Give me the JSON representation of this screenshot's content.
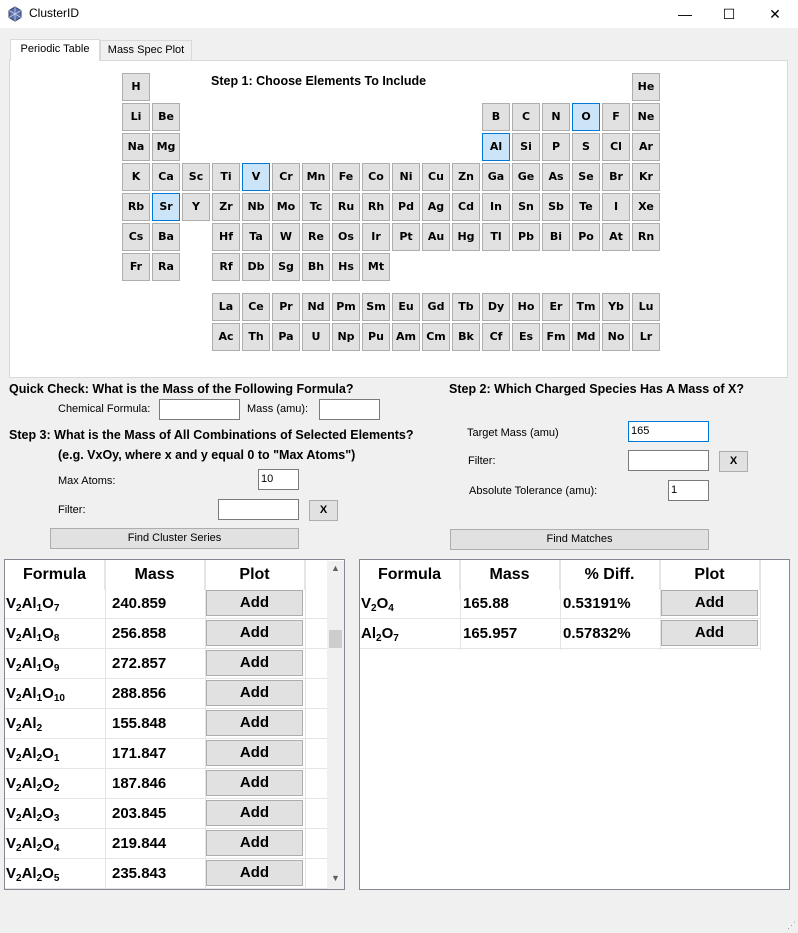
{
  "window": {
    "title": "ClusterID",
    "minimize": "—",
    "maximize": "☐",
    "close": "✕"
  },
  "tabs": [
    "Periodic Table",
    "Mass Spec Plot"
  ],
  "step1": {
    "title": "Step 1: Choose Elements To Include",
    "elements": [
      {
        "s": "H",
        "r": 0,
        "c": 0
      },
      {
        "s": "He",
        "r": 0,
        "c": 17
      },
      {
        "s": "Li",
        "r": 1,
        "c": 0
      },
      {
        "s": "Be",
        "r": 1,
        "c": 1
      },
      {
        "s": "B",
        "r": 1,
        "c": 12
      },
      {
        "s": "C",
        "r": 1,
        "c": 13
      },
      {
        "s": "N",
        "r": 1,
        "c": 14
      },
      {
        "s": "O",
        "r": 1,
        "c": 15,
        "sel": true
      },
      {
        "s": "F",
        "r": 1,
        "c": 16
      },
      {
        "s": "Ne",
        "r": 1,
        "c": 17
      },
      {
        "s": "Na",
        "r": 2,
        "c": 0
      },
      {
        "s": "Mg",
        "r": 2,
        "c": 1
      },
      {
        "s": "Al",
        "r": 2,
        "c": 12,
        "sel": true
      },
      {
        "s": "Si",
        "r": 2,
        "c": 13
      },
      {
        "s": "P",
        "r": 2,
        "c": 14
      },
      {
        "s": "S",
        "r": 2,
        "c": 15
      },
      {
        "s": "Cl",
        "r": 2,
        "c": 16
      },
      {
        "s": "Ar",
        "r": 2,
        "c": 17
      },
      {
        "s": "K",
        "r": 3,
        "c": 0
      },
      {
        "s": "Ca",
        "r": 3,
        "c": 1
      },
      {
        "s": "Sc",
        "r": 3,
        "c": 2
      },
      {
        "s": "Ti",
        "r": 3,
        "c": 3
      },
      {
        "s": "V",
        "r": 3,
        "c": 4,
        "sel": true
      },
      {
        "s": "Cr",
        "r": 3,
        "c": 5
      },
      {
        "s": "Mn",
        "r": 3,
        "c": 6
      },
      {
        "s": "Fe",
        "r": 3,
        "c": 7
      },
      {
        "s": "Co",
        "r": 3,
        "c": 8
      },
      {
        "s": "Ni",
        "r": 3,
        "c": 9
      },
      {
        "s": "Cu",
        "r": 3,
        "c": 10
      },
      {
        "s": "Zn",
        "r": 3,
        "c": 11
      },
      {
        "s": "Ga",
        "r": 3,
        "c": 12
      },
      {
        "s": "Ge",
        "r": 3,
        "c": 13
      },
      {
        "s": "As",
        "r": 3,
        "c": 14
      },
      {
        "s": "Se",
        "r": 3,
        "c": 15
      },
      {
        "s": "Br",
        "r": 3,
        "c": 16
      },
      {
        "s": "Kr",
        "r": 3,
        "c": 17
      },
      {
        "s": "Rb",
        "r": 4,
        "c": 0
      },
      {
        "s": "Sr",
        "r": 4,
        "c": 1,
        "sel": true
      },
      {
        "s": "Y",
        "r": 4,
        "c": 2
      },
      {
        "s": "Zr",
        "r": 4,
        "c": 3
      },
      {
        "s": "Nb",
        "r": 4,
        "c": 4
      },
      {
        "s": "Mo",
        "r": 4,
        "c": 5
      },
      {
        "s": "Tc",
        "r": 4,
        "c": 6
      },
      {
        "s": "Ru",
        "r": 4,
        "c": 7
      },
      {
        "s": "Rh",
        "r": 4,
        "c": 8
      },
      {
        "s": "Pd",
        "r": 4,
        "c": 9
      },
      {
        "s": "Ag",
        "r": 4,
        "c": 10
      },
      {
        "s": "Cd",
        "r": 4,
        "c": 11
      },
      {
        "s": "In",
        "r": 4,
        "c": 12
      },
      {
        "s": "Sn",
        "r": 4,
        "c": 13
      },
      {
        "s": "Sb",
        "r": 4,
        "c": 14
      },
      {
        "s": "Te",
        "r": 4,
        "c": 15
      },
      {
        "s": "I",
        "r": 4,
        "c": 16
      },
      {
        "s": "Xe",
        "r": 4,
        "c": 17
      },
      {
        "s": "Cs",
        "r": 5,
        "c": 0
      },
      {
        "s": "Ba",
        "r": 5,
        "c": 1
      },
      {
        "s": "Hf",
        "r": 5,
        "c": 3
      },
      {
        "s": "Ta",
        "r": 5,
        "c": 4
      },
      {
        "s": "W",
        "r": 5,
        "c": 5
      },
      {
        "s": "Re",
        "r": 5,
        "c": 6
      },
      {
        "s": "Os",
        "r": 5,
        "c": 7
      },
      {
        "s": "Ir",
        "r": 5,
        "c": 8
      },
      {
        "s": "Pt",
        "r": 5,
        "c": 9
      },
      {
        "s": "Au",
        "r": 5,
        "c": 10
      },
      {
        "s": "Hg",
        "r": 5,
        "c": 11
      },
      {
        "s": "Tl",
        "r": 5,
        "c": 12
      },
      {
        "s": "Pb",
        "r": 5,
        "c": 13
      },
      {
        "s": "Bi",
        "r": 5,
        "c": 14
      },
      {
        "s": "Po",
        "r": 5,
        "c": 15
      },
      {
        "s": "At",
        "r": 5,
        "c": 16
      },
      {
        "s": "Rn",
        "r": 5,
        "c": 17
      },
      {
        "s": "Fr",
        "r": 6,
        "c": 0
      },
      {
        "s": "Ra",
        "r": 6,
        "c": 1
      },
      {
        "s": "Rf",
        "r": 6,
        "c": 3
      },
      {
        "s": "Db",
        "r": 6,
        "c": 4
      },
      {
        "s": "Sg",
        "r": 6,
        "c": 5
      },
      {
        "s": "Bh",
        "r": 6,
        "c": 6
      },
      {
        "s": "Hs",
        "r": 6,
        "c": 7
      },
      {
        "s": "Mt",
        "r": 6,
        "c": 8
      },
      {
        "s": "La",
        "r": 7,
        "c": 3
      },
      {
        "s": "Ce",
        "r": 7,
        "c": 4
      },
      {
        "s": "Pr",
        "r": 7,
        "c": 5
      },
      {
        "s": "Nd",
        "r": 7,
        "c": 6
      },
      {
        "s": "Pm",
        "r": 7,
        "c": 7
      },
      {
        "s": "Sm",
        "r": 7,
        "c": 8
      },
      {
        "s": "Eu",
        "r": 7,
        "c": 9
      },
      {
        "s": "Gd",
        "r": 7,
        "c": 10
      },
      {
        "s": "Tb",
        "r": 7,
        "c": 11
      },
      {
        "s": "Dy",
        "r": 7,
        "c": 12
      },
      {
        "s": "Ho",
        "r": 7,
        "c": 13
      },
      {
        "s": "Er",
        "r": 7,
        "c": 14
      },
      {
        "s": "Tm",
        "r": 7,
        "c": 15
      },
      {
        "s": "Yb",
        "r": 7,
        "c": 16
      },
      {
        "s": "Lu",
        "r": 7,
        "c": 17
      },
      {
        "s": "Ac",
        "r": 8,
        "c": 3
      },
      {
        "s": "Th",
        "r": 8,
        "c": 4
      },
      {
        "s": "Pa",
        "r": 8,
        "c": 5
      },
      {
        "s": "U",
        "r": 8,
        "c": 6
      },
      {
        "s": "Np",
        "r": 8,
        "c": 7
      },
      {
        "s": "Pu",
        "r": 8,
        "c": 8
      },
      {
        "s": "Am",
        "r": 8,
        "c": 9
      },
      {
        "s": "Cm",
        "r": 8,
        "c": 10
      },
      {
        "s": "Bk",
        "r": 8,
        "c": 11
      },
      {
        "s": "Cf",
        "r": 8,
        "c": 12
      },
      {
        "s": "Es",
        "r": 8,
        "c": 13
      },
      {
        "s": "Fm",
        "r": 8,
        "c": 14
      },
      {
        "s": "Md",
        "r": 8,
        "c": 15
      },
      {
        "s": "No",
        "r": 8,
        "c": 16
      },
      {
        "s": "Lr",
        "r": 8,
        "c": 17
      }
    ]
  },
  "quick_check": {
    "title": "Quick Check: What is the Mass of the Following Formula?",
    "formula_label": "Chemical Formula:",
    "formula_value": "",
    "mass_label": "Mass (amu):",
    "mass_value": ""
  },
  "step3": {
    "title": "Step 3: What is the Mass of All Combinations of Selected Elements?",
    "subtitle": "(e.g. VxOy, where x and y equal 0 to \"Max Atoms\")",
    "max_atoms_label": "Max Atoms:",
    "max_atoms_value": "10",
    "filter_label": "Filter:",
    "filter_value": "",
    "clear_label": "X",
    "button_label": "Find Cluster Series"
  },
  "step2": {
    "title": "Step 2: Which Charged Species Has A Mass of X?",
    "target_label": "Target Mass (amu)",
    "target_value": "165",
    "filter_label": "Filter:",
    "filter_value": "",
    "clear_label": "X",
    "tolerance_label": "Absolute Tolerance (amu):",
    "tolerance_value": "1",
    "button_label": "Find Matches"
  },
  "series_table": {
    "headers": [
      "Formula",
      "Mass",
      "Plot"
    ],
    "rows": [
      {
        "f": [
          [
            "V",
            "2"
          ],
          [
            "Al",
            "1"
          ],
          [
            "O",
            "7"
          ]
        ],
        "mass": "240.859",
        "plot": "Add"
      },
      {
        "f": [
          [
            "V",
            "2"
          ],
          [
            "Al",
            "1"
          ],
          [
            "O",
            "8"
          ]
        ],
        "mass": "256.858",
        "plot": "Add"
      },
      {
        "f": [
          [
            "V",
            "2"
          ],
          [
            "Al",
            "1"
          ],
          [
            "O",
            "9"
          ]
        ],
        "mass": "272.857",
        "plot": "Add"
      },
      {
        "f": [
          [
            "V",
            "2"
          ],
          [
            "Al",
            "1"
          ],
          [
            "O",
            "10"
          ]
        ],
        "mass": "288.856",
        "plot": "Add"
      },
      {
        "f": [
          [
            "V",
            "2"
          ],
          [
            "Al",
            "2"
          ]
        ],
        "mass": "155.848",
        "plot": "Add"
      },
      {
        "f": [
          [
            "V",
            "2"
          ],
          [
            "Al",
            "2"
          ],
          [
            "O",
            "1"
          ]
        ],
        "mass": "171.847",
        "plot": "Add"
      },
      {
        "f": [
          [
            "V",
            "2"
          ],
          [
            "Al",
            "2"
          ],
          [
            "O",
            "2"
          ]
        ],
        "mass": "187.846",
        "plot": "Add"
      },
      {
        "f": [
          [
            "V",
            "2"
          ],
          [
            "Al",
            "2"
          ],
          [
            "O",
            "3"
          ]
        ],
        "mass": "203.845",
        "plot": "Add"
      },
      {
        "f": [
          [
            "V",
            "2"
          ],
          [
            "Al",
            "2"
          ],
          [
            "O",
            "4"
          ]
        ],
        "mass": "219.844",
        "plot": "Add"
      },
      {
        "f": [
          [
            "V",
            "2"
          ],
          [
            "Al",
            "2"
          ],
          [
            "O",
            "5"
          ]
        ],
        "mass": "235.843",
        "plot": "Add"
      }
    ]
  },
  "match_table": {
    "headers": [
      "Formula",
      "Mass",
      "% Diff.",
      "Plot"
    ],
    "rows": [
      {
        "f": [
          [
            "V",
            "2"
          ],
          [
            "O",
            "4"
          ]
        ],
        "mass": "165.88",
        "diff": "0.53191%",
        "plot": "Add"
      },
      {
        "f": [
          [
            "Al",
            "2"
          ],
          [
            "O",
            "7"
          ]
        ],
        "mass": "165.957",
        "diff": "0.57832%",
        "plot": "Add"
      }
    ]
  },
  "icons": {
    "scroll_up": "▲",
    "scroll_down": "▼",
    "grip": "⋰"
  },
  "colors": {
    "selected_fill": "#cce4f7",
    "selected_border": "#0078d7",
    "button_fill": "#e1e1e1"
  }
}
